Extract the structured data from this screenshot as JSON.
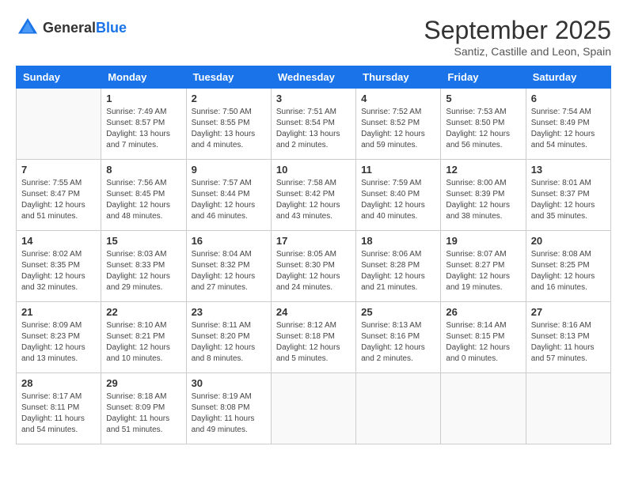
{
  "header": {
    "logo_general": "General",
    "logo_blue": "Blue",
    "month": "September 2025",
    "location": "Santiz, Castille and Leon, Spain"
  },
  "days": [
    "Sunday",
    "Monday",
    "Tuesday",
    "Wednesday",
    "Thursday",
    "Friday",
    "Saturday"
  ],
  "weeks": [
    [
      {
        "date": "",
        "info": ""
      },
      {
        "date": "1",
        "info": "Sunrise: 7:49 AM\nSunset: 8:57 PM\nDaylight: 13 hours\nand 7 minutes."
      },
      {
        "date": "2",
        "info": "Sunrise: 7:50 AM\nSunset: 8:55 PM\nDaylight: 13 hours\nand 4 minutes."
      },
      {
        "date": "3",
        "info": "Sunrise: 7:51 AM\nSunset: 8:54 PM\nDaylight: 13 hours\nand 2 minutes."
      },
      {
        "date": "4",
        "info": "Sunrise: 7:52 AM\nSunset: 8:52 PM\nDaylight: 12 hours\nand 59 minutes."
      },
      {
        "date": "5",
        "info": "Sunrise: 7:53 AM\nSunset: 8:50 PM\nDaylight: 12 hours\nand 56 minutes."
      },
      {
        "date": "6",
        "info": "Sunrise: 7:54 AM\nSunset: 8:49 PM\nDaylight: 12 hours\nand 54 minutes."
      }
    ],
    [
      {
        "date": "7",
        "info": "Sunrise: 7:55 AM\nSunset: 8:47 PM\nDaylight: 12 hours\nand 51 minutes."
      },
      {
        "date": "8",
        "info": "Sunrise: 7:56 AM\nSunset: 8:45 PM\nDaylight: 12 hours\nand 48 minutes."
      },
      {
        "date": "9",
        "info": "Sunrise: 7:57 AM\nSunset: 8:44 PM\nDaylight: 12 hours\nand 46 minutes."
      },
      {
        "date": "10",
        "info": "Sunrise: 7:58 AM\nSunset: 8:42 PM\nDaylight: 12 hours\nand 43 minutes."
      },
      {
        "date": "11",
        "info": "Sunrise: 7:59 AM\nSunset: 8:40 PM\nDaylight: 12 hours\nand 40 minutes."
      },
      {
        "date": "12",
        "info": "Sunrise: 8:00 AM\nSunset: 8:39 PM\nDaylight: 12 hours\nand 38 minutes."
      },
      {
        "date": "13",
        "info": "Sunrise: 8:01 AM\nSunset: 8:37 PM\nDaylight: 12 hours\nand 35 minutes."
      }
    ],
    [
      {
        "date": "14",
        "info": "Sunrise: 8:02 AM\nSunset: 8:35 PM\nDaylight: 12 hours\nand 32 minutes."
      },
      {
        "date": "15",
        "info": "Sunrise: 8:03 AM\nSunset: 8:33 PM\nDaylight: 12 hours\nand 29 minutes."
      },
      {
        "date": "16",
        "info": "Sunrise: 8:04 AM\nSunset: 8:32 PM\nDaylight: 12 hours\nand 27 minutes."
      },
      {
        "date": "17",
        "info": "Sunrise: 8:05 AM\nSunset: 8:30 PM\nDaylight: 12 hours\nand 24 minutes."
      },
      {
        "date": "18",
        "info": "Sunrise: 8:06 AM\nSunset: 8:28 PM\nDaylight: 12 hours\nand 21 minutes."
      },
      {
        "date": "19",
        "info": "Sunrise: 8:07 AM\nSunset: 8:27 PM\nDaylight: 12 hours\nand 19 minutes."
      },
      {
        "date": "20",
        "info": "Sunrise: 8:08 AM\nSunset: 8:25 PM\nDaylight: 12 hours\nand 16 minutes."
      }
    ],
    [
      {
        "date": "21",
        "info": "Sunrise: 8:09 AM\nSunset: 8:23 PM\nDaylight: 12 hours\nand 13 minutes."
      },
      {
        "date": "22",
        "info": "Sunrise: 8:10 AM\nSunset: 8:21 PM\nDaylight: 12 hours\nand 10 minutes."
      },
      {
        "date": "23",
        "info": "Sunrise: 8:11 AM\nSunset: 8:20 PM\nDaylight: 12 hours\nand 8 minutes."
      },
      {
        "date": "24",
        "info": "Sunrise: 8:12 AM\nSunset: 8:18 PM\nDaylight: 12 hours\nand 5 minutes."
      },
      {
        "date": "25",
        "info": "Sunrise: 8:13 AM\nSunset: 8:16 PM\nDaylight: 12 hours\nand 2 minutes."
      },
      {
        "date": "26",
        "info": "Sunrise: 8:14 AM\nSunset: 8:15 PM\nDaylight: 12 hours\nand 0 minutes."
      },
      {
        "date": "27",
        "info": "Sunrise: 8:16 AM\nSunset: 8:13 PM\nDaylight: 11 hours\nand 57 minutes."
      }
    ],
    [
      {
        "date": "28",
        "info": "Sunrise: 8:17 AM\nSunset: 8:11 PM\nDaylight: 11 hours\nand 54 minutes."
      },
      {
        "date": "29",
        "info": "Sunrise: 8:18 AM\nSunset: 8:09 PM\nDaylight: 11 hours\nand 51 minutes."
      },
      {
        "date": "30",
        "info": "Sunrise: 8:19 AM\nSunset: 8:08 PM\nDaylight: 11 hours\nand 49 minutes."
      },
      {
        "date": "",
        "info": ""
      },
      {
        "date": "",
        "info": ""
      },
      {
        "date": "",
        "info": ""
      },
      {
        "date": "",
        "info": ""
      }
    ]
  ]
}
